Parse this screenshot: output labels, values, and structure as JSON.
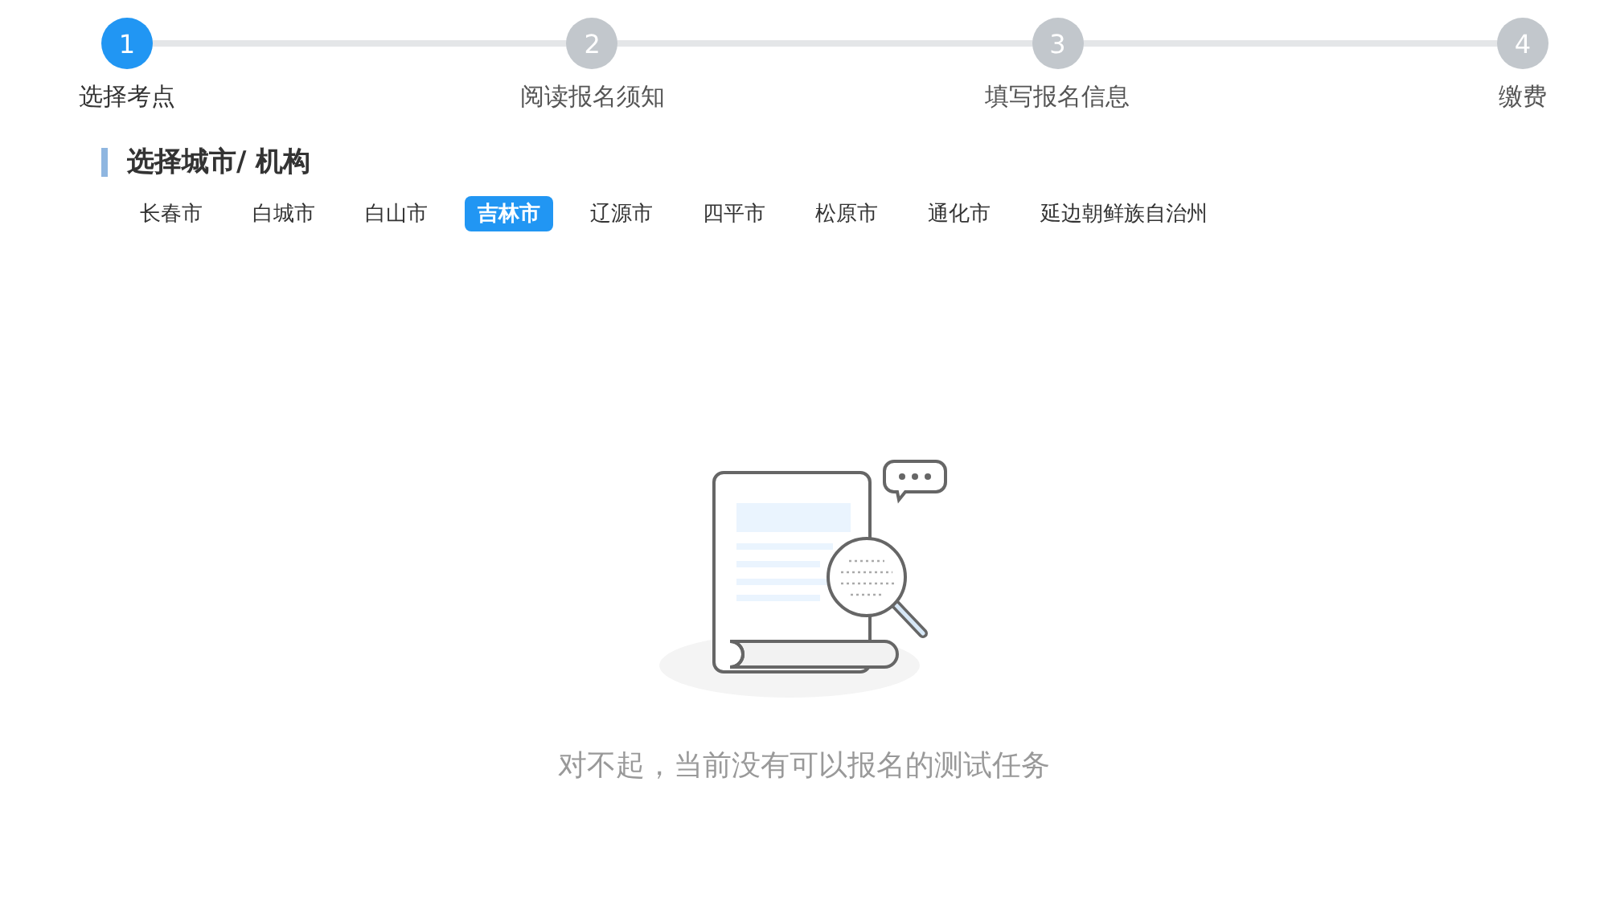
{
  "steps": [
    {
      "number": "1",
      "label": "选择考点",
      "selected": true
    },
    {
      "number": "2",
      "label": "阅读报名须知",
      "selected": false
    },
    {
      "number": "3",
      "label": "填写报名信息",
      "selected": false
    },
    {
      "number": "4",
      "label": "缴费",
      "selected": false
    }
  ],
  "section_title": "选择城市/ 机构",
  "cities": [
    {
      "label": "长春市",
      "selected": false
    },
    {
      "label": "白城市",
      "selected": false
    },
    {
      "label": "白山市",
      "selected": false
    },
    {
      "label": "吉林市",
      "selected": true
    },
    {
      "label": "辽源市",
      "selected": false
    },
    {
      "label": "四平市",
      "selected": false
    },
    {
      "label": "松原市",
      "selected": false
    },
    {
      "label": "通化市",
      "selected": false
    },
    {
      "label": "延边朝鲜族自治州",
      "selected": false
    }
  ],
  "empty_message": "对不起，当前没有可以报名的测试任务"
}
